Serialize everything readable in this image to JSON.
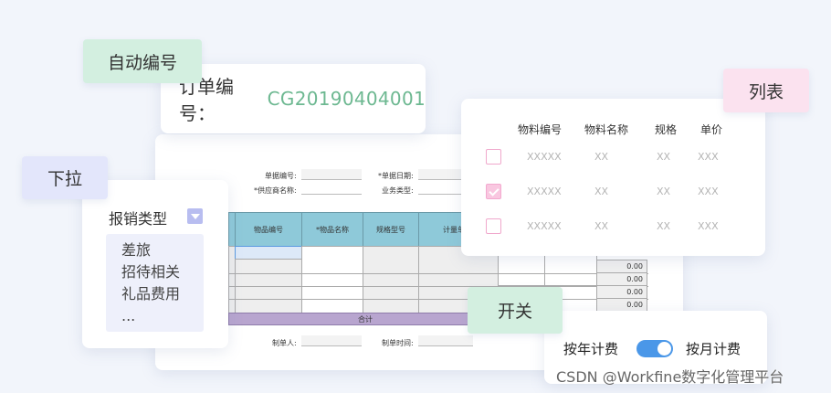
{
  "tags": {
    "auto_number": "自动编号",
    "dropdown": "下拉",
    "list": "列表",
    "switch": "开关"
  },
  "order": {
    "label": "订单编号：",
    "value": "CG20190404001"
  },
  "sheet": {
    "doc_no_label": "单据编号:",
    "doc_date_label": "*单据日期:",
    "supplier_label": "*供应商名称:",
    "biz_type_label": "业务类型:",
    "columns": [
      "物品编号",
      "*物品名称",
      "规格型号",
      "计量单"
    ],
    "total_label": "合计",
    "maker_label": "制单人:",
    "make_time_label": "制单时间:",
    "amounts": [
      "0.00",
      "0.00",
      "0.00",
      "0.00"
    ]
  },
  "dropdown": {
    "label": "报销类型",
    "options": [
      "差旅",
      "招待相关",
      "礼品费用",
      "..."
    ]
  },
  "list": {
    "headers": [
      "物料编号",
      "物料名称",
      "规格",
      "单价"
    ],
    "rows": [
      {
        "checked": false,
        "code": "XXXXX",
        "name": "XX",
        "spec": "XX",
        "price": "XXX"
      },
      {
        "checked": true,
        "code": "XXXXX",
        "name": "XX",
        "spec": "XX",
        "price": "XXX"
      },
      {
        "checked": false,
        "code": "XXXXX",
        "name": "XX",
        "spec": "XX",
        "price": "XXX"
      }
    ]
  },
  "switch": {
    "left_label": "按年计费",
    "right_label": "按月计费",
    "on": true
  },
  "watermark": "CSDN @Workfine数字化管理平台",
  "colors": {
    "accent_green": "#6db891",
    "toggle_blue": "#4a97e8",
    "header_teal": "#8ec9d9",
    "total_purple": "#b8a5cf"
  }
}
